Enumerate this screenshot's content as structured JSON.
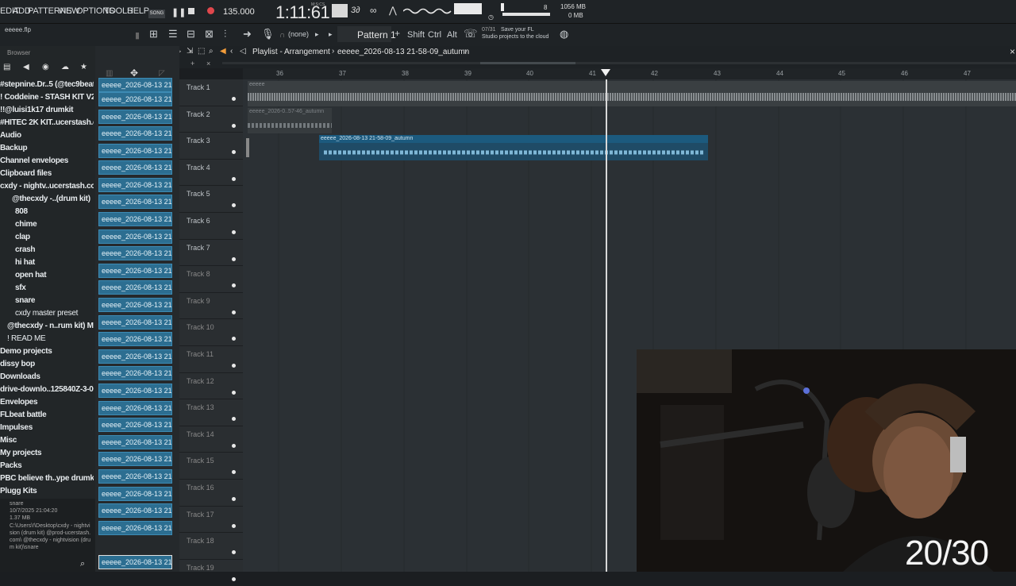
{
  "menu": [
    "EDIT",
    "ADD",
    "PATTERNS",
    "VIEW",
    "OPTIONS",
    "TOOLS",
    "HELP"
  ],
  "transport": {
    "mode": "SONG",
    "tempo": "135.000",
    "time": "1:11:61",
    "time_unit": "M:S:CS",
    "memory": "1056 MB",
    "memory2": "0 MB",
    "cpu_voices": "8"
  },
  "toolbar": {
    "pattern": "Pattern 1",
    "none": "(none)",
    "shift": "Shift",
    "ctrl": "Ctrl",
    "alt": "Alt",
    "news_count": "07/31",
    "news_line1": "Save your FL",
    "news_line2": "Studio projects to the cloud"
  },
  "file": {
    "name": "eeeee.flp"
  },
  "browser": {
    "title": "Browser",
    "items": [
      "#stepnine.Dr..5 (@tec9beat)",
      "! Coddeine - STASH KIT V2 I",
      "!!@luisi1k17 drumkit",
      "#HITEC 2K KIT..ucerstash.com",
      "Audio",
      "Backup",
      "Channel envelopes",
      "Clipboard files",
      "cxdy - nightv..ucerstash.com",
      "@thecxdy -..(drum kit)",
      "808",
      "chime",
      "clap",
      "crash",
      "hi hat",
      "open hat",
      "sfx",
      "snare",
      "cxdy master preset",
      "@thecxdy - n..rum kit) MAC",
      "! READ ME",
      "Demo projects",
      "dissy bop",
      "Downloads",
      "drive-downlo..125840Z-3-001",
      "Envelopes",
      "FLbeat battle",
      "Impulses",
      "Misc",
      "My projects",
      "Packs",
      "PBC believe th..ype drumkit 1",
      "Plugg Kits"
    ],
    "info": {
      "name": "snare",
      "date": "10/7/2025 21:04:20",
      "size": "1.37 MB",
      "path": "C:\\Users\\!\\Desktop\\cxdy - nightvision (drum kit) @prod-ucerstash.com\\ @thecxdy - nightvision (drum kit)\\snare"
    }
  },
  "clips": [
    "eeeee_2026-08-13 21-4...",
    "eeeee_2026-08-13 21-4...",
    "eeeee_2026-08-13 21-4...",
    "eeeee_2026-08-13 21-4...",
    "eeeee_2026-08-13 21-4...",
    "eeeee_2026-08-13 21-4...",
    "eeeee_2026-08-13 21-4...",
    "eeeee_2026-08-13 21-4...",
    "eeeee_2026-08-13 21-4...",
    "eeeee_2026-08-13 21-4...",
    "eeeee_2026-08-13 21-4...",
    "eeeee_2026-08-13 21-5...",
    "eeeee_2026-08-13 21-5...",
    "eeeee_2026-08-13 21-5...",
    "eeeee_2026-08-13 21-5...",
    "eeeee_2026-08-13 21-5...",
    "eeeee_2026-08-13 21-5...",
    "eeeee_2026-08-13 21-5...",
    "eeeee_2026-08-13 21-5...",
    "eeeee_2026-08-13 21-5...",
    "eeeee_2026-08-13 21-5...",
    "eeeee_2026-08-13 21-5...",
    "eeeee_2026-08-13 21-5...",
    "eeeee_2026-08-13 21-5...",
    "eeeee_2026-08-13 21-5...",
    "eeeee_2026-08-13 21-5...",
    "eeeee_2026-08-13 21-5...",
    "eeeee_2026-08-13 21-5..."
  ],
  "playlist": {
    "title": "Playlist - Arrangement",
    "arrangement": "eeeee_2026-08-13 21-58-09_autumn",
    "bars": [
      "36",
      "37",
      "38",
      "39",
      "40",
      "41",
      "42",
      "43",
      "44",
      "45",
      "46",
      "47"
    ],
    "tracks": [
      "Track 1",
      "Track 2",
      "Track 3",
      "Track 4",
      "Track 5",
      "Track 6",
      "Track 7",
      "Track 8",
      "Track 9",
      "Track 10",
      "Track 11",
      "Track 12",
      "Track 13",
      "Track 14",
      "Track 15",
      "Track 16",
      "Track 17",
      "Track 18",
      "Track 19"
    ],
    "clip_track1": "eeeee",
    "clip_track2": "eeeee_2026-0..57-46_autumn",
    "clip_track3": "eeeee_2026-08-13 21-58-09_autumn"
  },
  "overlay": {
    "counter": "20/30"
  }
}
